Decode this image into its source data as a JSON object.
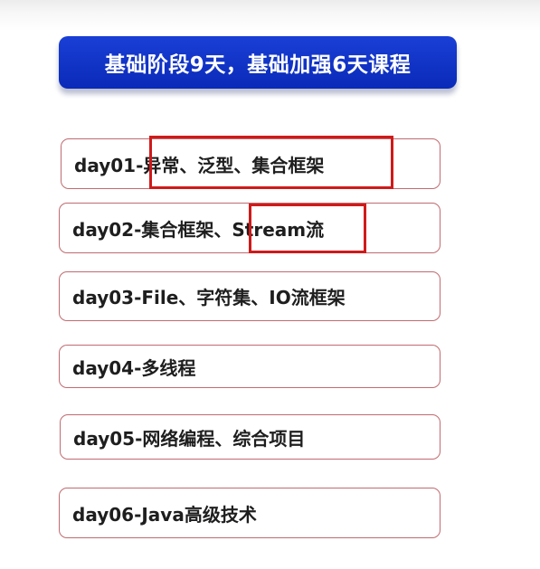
{
  "banner": {
    "title": "基础阶段9天，基础加强6天课程"
  },
  "days": [
    {
      "label": "day01-异常、泛型、集合框架"
    },
    {
      "label": "day02-集合框架、Stream流"
    },
    {
      "label": "day03-File、字符集、IO流框架"
    },
    {
      "label": "day04-多线程"
    },
    {
      "label": "day05-网络编程、综合项目"
    },
    {
      "label": "day06-Java高级技术"
    }
  ],
  "colors": {
    "banner_bg": "#0f30c4",
    "card_border": "#c06b70",
    "highlight": "#cf1a1a"
  }
}
